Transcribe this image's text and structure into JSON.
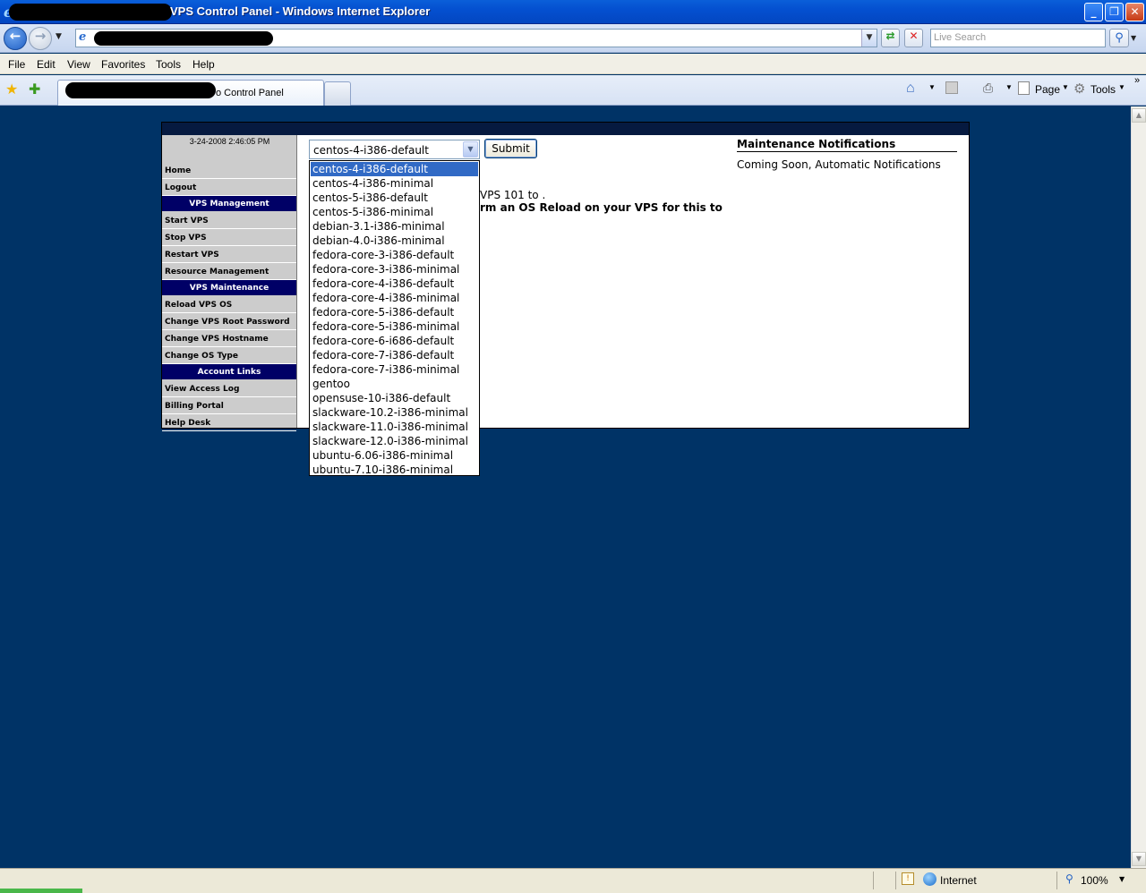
{
  "window": {
    "title": "VPS Control Panel - Windows Internet Explorer",
    "buttons": {
      "minimize": "_",
      "maximize": "❐",
      "close": "✕"
    }
  },
  "addressbar": {
    "url": "",
    "search_placeholder": "Live Search"
  },
  "menu": [
    "File",
    "Edit",
    "View",
    "Favorites",
    "Tools",
    "Help"
  ],
  "tab": {
    "title": "o Control Panel"
  },
  "commandbar": {
    "page_label": "Page",
    "tools_label": "Tools"
  },
  "sidebar": {
    "clock": "3-24-2008 2:46:05 PM",
    "items": [
      {
        "label": "Home",
        "kind": "link"
      },
      {
        "label": "Logout",
        "kind": "link"
      },
      {
        "label": "VPS Management",
        "kind": "head"
      },
      {
        "label": "Start VPS",
        "kind": "link"
      },
      {
        "label": "Stop VPS",
        "kind": "link"
      },
      {
        "label": "Restart VPS",
        "kind": "link"
      },
      {
        "label": "Resource Management",
        "kind": "link"
      },
      {
        "label": "VPS Maintenance",
        "kind": "head"
      },
      {
        "label": "Reload VPS OS",
        "kind": "link"
      },
      {
        "label": "Change VPS Root Password",
        "kind": "link"
      },
      {
        "label": "Change VPS Hostname",
        "kind": "link"
      },
      {
        "label": "Change OS Type",
        "kind": "link"
      },
      {
        "label": "Account Links",
        "kind": "head"
      },
      {
        "label": "View Access Log",
        "kind": "link"
      },
      {
        "label": "Billing Portal",
        "kind": "link"
      },
      {
        "label": "Help Desk",
        "kind": "link"
      }
    ]
  },
  "main": {
    "select_value": "centos-4-i386-default",
    "submit_label": "Submit",
    "partial_line_1": "VPS 101 to .",
    "partial_line_2": "rm an OS Reload on your VPS for this to",
    "os_options": [
      "centos-4-i386-default",
      "centos-4-i386-minimal",
      "centos-5-i386-default",
      "centos-5-i386-minimal",
      "debian-3.1-i386-minimal",
      "debian-4.0-i386-minimal",
      "fedora-core-3-i386-default",
      "fedora-core-3-i386-minimal",
      "fedora-core-4-i386-default",
      "fedora-core-4-i386-minimal",
      "fedora-core-5-i386-default",
      "fedora-core-5-i386-minimal",
      "fedora-core-6-i686-default",
      "fedora-core-7-i386-default",
      "fedora-core-7-i386-minimal",
      "gentoo",
      "opensuse-10-i386-default",
      "slackware-10.2-i386-minimal",
      "slackware-11.0-i386-minimal",
      "slackware-12.0-i386-minimal",
      "ubuntu-6.06-i386-minimal",
      "ubuntu-7.10-i386-minimal"
    ],
    "selected_index": 0
  },
  "notifications": {
    "title": "Maintenance Notifications",
    "body": "Coming Soon, Automatic Notifications"
  },
  "statusbar": {
    "zone": "Internet",
    "zoom": "100%"
  },
  "colors": {
    "page_background": "#003366",
    "nav_header": "#000066",
    "selected_option": "#316ac5"
  }
}
